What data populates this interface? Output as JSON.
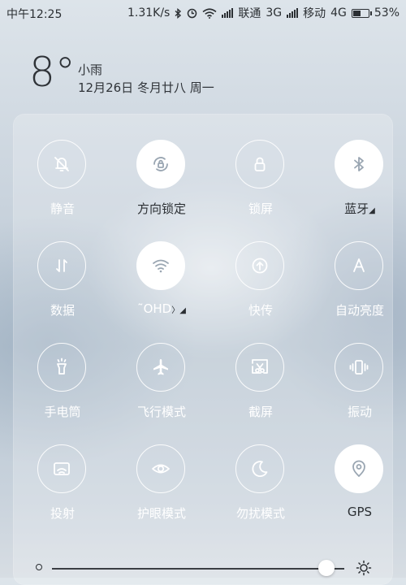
{
  "status": {
    "time": "中午12:25",
    "speed": "1.31K/s",
    "carrier1": "联通",
    "net1": "3G",
    "carrier2": "移动",
    "net2": "4G",
    "battery_text": "53%",
    "battery_level": 0.53
  },
  "weather": {
    "temp": "8°",
    "condition": "小雨",
    "date": "12月26日 冬月廿八 周一"
  },
  "tiles": [
    {
      "label": "静音",
      "icon": "bell-off-icon",
      "on": false
    },
    {
      "label": "方向锁定",
      "icon": "rotation-lock-icon",
      "on": true
    },
    {
      "label": "锁屏",
      "icon": "lock-icon",
      "on": false
    },
    {
      "label": "蓝牙",
      "icon": "bluetooth-icon",
      "on": true,
      "expand": "◢"
    },
    {
      "label": "数据",
      "icon": "data-arrows-icon",
      "on": false
    },
    {
      "label": "˜OHD",
      "icon": "wifi-icon",
      "on": true,
      "expand": "〉◢"
    },
    {
      "label": "快传",
      "icon": "quick-transfer-icon",
      "on": false
    },
    {
      "label": "自动亮度",
      "icon": "auto-brightness-icon",
      "on": false
    },
    {
      "label": "手电筒",
      "icon": "flashlight-icon",
      "on": false
    },
    {
      "label": "飞行模式",
      "icon": "airplane-icon",
      "on": false
    },
    {
      "label": "截屏",
      "icon": "screenshot-icon",
      "on": false
    },
    {
      "label": "振动",
      "icon": "vibrate-icon",
      "on": false
    },
    {
      "label": "投射",
      "icon": "cast-icon",
      "on": false
    },
    {
      "label": "护眼模式",
      "icon": "eye-icon",
      "on": false
    },
    {
      "label": "勿扰模式",
      "icon": "moon-icon",
      "on": false
    },
    {
      "label": "GPS",
      "icon": "gps-icon",
      "on": true
    }
  ],
  "brightness": {
    "level": 0.94
  },
  "colors": {
    "icon_on": "#9aa6b2",
    "icon_off": "#ffffff"
  }
}
